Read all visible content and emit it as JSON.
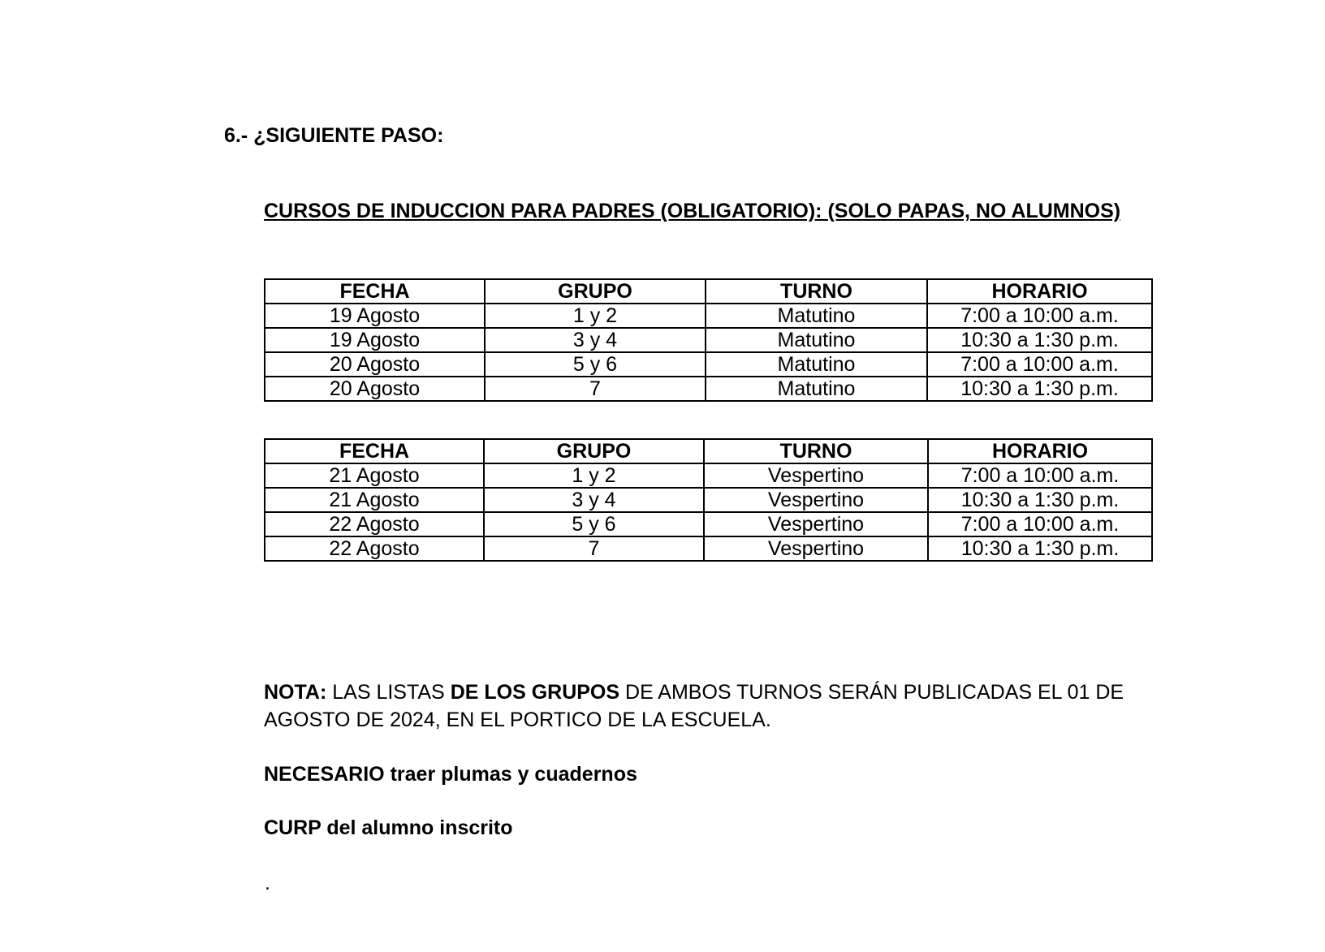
{
  "heading": "6.- ¿SIGUIENTE PASO:",
  "course_title": "CURSOS DE INDUCCION PARA PADRES (OBLIGATORIO): (SOLO PAPAS, NO ALUMNOS)",
  "table_headers": [
    "FECHA",
    "GRUPO",
    "TURNO",
    "HORARIO"
  ],
  "schedule_morning": [
    [
      "19 Agosto",
      "1 y 2",
      "Matutino",
      "7:00 a 10:00 a.m."
    ],
    [
      "19 Agosto",
      "3 y 4",
      "Matutino",
      "10:30 a 1:30 p.m."
    ],
    [
      "20 Agosto",
      "5 y 6",
      "Matutino",
      "7:00 a 10:00 a.m."
    ],
    [
      "20 Agosto",
      "7",
      "Matutino",
      "10:30 a 1:30 p.m."
    ]
  ],
  "schedule_afternoon": [
    [
      "21 Agosto",
      "1 y 2",
      "Vespertino",
      "7:00 a 10:00 a.m."
    ],
    [
      "21 Agosto",
      "3 y 4",
      "Vespertino",
      "10:30 a 1:30 p.m."
    ],
    [
      "22 Agosto",
      "5 y 6",
      "Vespertino",
      "7:00 a 10:00 a.m."
    ],
    [
      "22 Agosto",
      "7",
      "Vespertino",
      "10:30 a 1:30 p.m."
    ]
  ],
  "note": {
    "label": "NOTA:",
    "part1": " LAS LISTAS ",
    "bold_part": "DE LOS GRUPOS",
    "part2": " DE AMBOS TURNOS SERÁN PUBLICADAS EL 01 DE AGOSTO DE 2024, EN EL PORTICO DE LA ESCUELA."
  },
  "requirements": [
    "NECESARIO traer plumas y cuadernos",
    "CURP del alumno inscrito"
  ],
  "trailing_mark": "."
}
